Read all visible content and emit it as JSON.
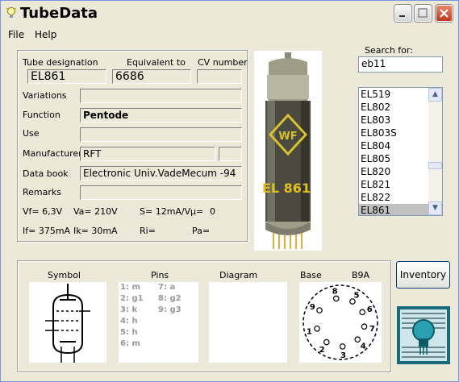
{
  "window": {
    "title": "TubeData"
  },
  "menu": {
    "file": "File",
    "help": "Help"
  },
  "search": {
    "label": "Search for:",
    "value": "eb11"
  },
  "tube_list": {
    "items": [
      "EL519",
      "EL802",
      "EL803",
      "EL803S",
      "EL804",
      "EL805",
      "EL820",
      "EL821",
      "EL822",
      "EL861"
    ],
    "selected": "EL861"
  },
  "headers": {
    "designation": "Tube designation",
    "equivalent": "Equivalent to",
    "cv": "CV number"
  },
  "values": {
    "designation": "EL861",
    "equivalent": "6686",
    "cv": "",
    "variations": "",
    "function": "Pentode",
    "use": "",
    "manufacturer": "RFT",
    "manufacturer_extra": "",
    "data_book": "Electronic Univ.VadeMecum -94",
    "remarks": ""
  },
  "labels": {
    "variations": "Variations",
    "function": "Function",
    "use": "Use",
    "manufacturer": "Manufacturer",
    "data_book": "Data book",
    "remarks": "Remarks"
  },
  "params": {
    "vf": "Vf= 6,3V",
    "va": "Va= 210V",
    "s": "S= 12mA/V",
    "mu": "µ=",
    "mu_val": "0",
    "if": "If= 375mA",
    "ik": "Ik= 30mA",
    "ri": "Ri=",
    "pa": "Pa="
  },
  "bottom": {
    "symbol": "Symbol",
    "pins": "Pins",
    "diagram": "Diagram",
    "base": "Base",
    "base_type": "B9A",
    "pins_list": [
      "1: m",
      "2: g1",
      "3: k",
      "4: h",
      "5: h",
      "6: m",
      "7: a",
      "8: g2",
      "9: g3"
    ],
    "base_numbers": [
      "1",
      "2",
      "3",
      "4",
      "5",
      "6",
      "7",
      "8",
      "9"
    ]
  },
  "photo": {
    "brand": "WF",
    "print": "EL 861"
  },
  "inventory_button": "Inventory",
  "colors": {
    "title_bg": "#ece9d8",
    "close_btn": "#c0391b"
  }
}
